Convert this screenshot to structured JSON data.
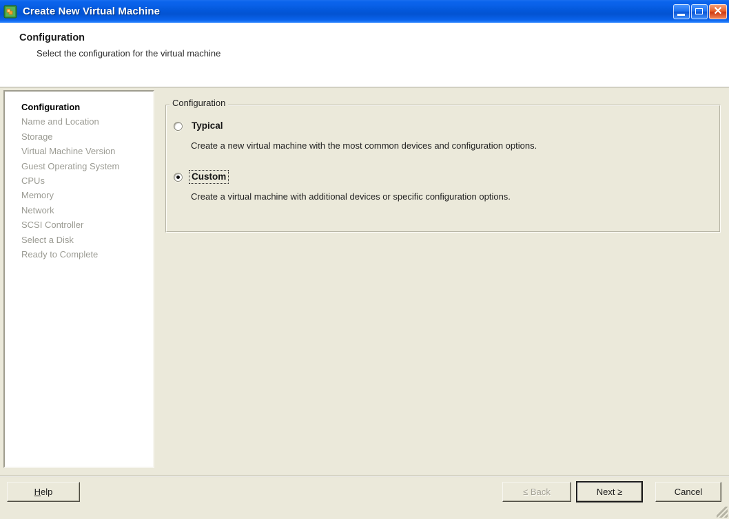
{
  "window": {
    "title": "Create New Virtual Machine",
    "icon": "virtual-machine-icon",
    "controls": {
      "minimize": "minimize-icon",
      "maximize": "maximize-restore-icon",
      "close": "✕"
    }
  },
  "header": {
    "title": "Configuration",
    "subtitle": "Select the configuration for the virtual machine"
  },
  "sidebar": {
    "items": [
      {
        "label": "Configuration",
        "active": true
      },
      {
        "label": "Name and Location",
        "active": false
      },
      {
        "label": "Storage",
        "active": false
      },
      {
        "label": "Virtual Machine Version",
        "active": false
      },
      {
        "label": "Guest Operating System",
        "active": false
      },
      {
        "label": "CPUs",
        "active": false
      },
      {
        "label": "Memory",
        "active": false
      },
      {
        "label": "Network",
        "active": false
      },
      {
        "label": "SCSI Controller",
        "active": false
      },
      {
        "label": "Select a Disk",
        "active": false
      },
      {
        "label": "Ready to Complete",
        "active": false
      }
    ]
  },
  "main": {
    "groupbox_legend": "Configuration",
    "options": [
      {
        "label": "Typical",
        "description": "Create a new virtual machine with the most common devices and configuration options.",
        "selected": false,
        "focused": false
      },
      {
        "label": "Custom",
        "description": "Create a virtual machine with additional devices or specific configuration options.",
        "selected": true,
        "focused": true
      }
    ]
  },
  "footer": {
    "help": {
      "mnemonic": "H",
      "rest": "elp"
    },
    "back": "≤ Back",
    "next": "Next ≥",
    "cancel": "Cancel"
  },
  "colors": {
    "titlebar_blue": "#0a62ea",
    "body_beige": "#ebe9da",
    "panel_white": "#ffffff",
    "disabled_text": "#a4a296",
    "nav_inactive": "#9b9b93"
  }
}
